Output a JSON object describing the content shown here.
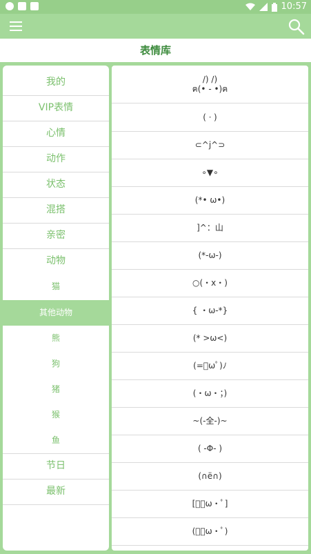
{
  "status_bar": {
    "time": "10:57",
    "icons": [
      "notification-dot-icon",
      "app-notification-icon",
      "image-notification-icon",
      "wifi-icon",
      "signal-icon",
      "battery-icon"
    ]
  },
  "toolbar": {
    "menu_icon": "hamburger-menu-icon",
    "search_icon": "search-icon",
    "accent_color": "#a5d99a"
  },
  "page_title": "表情库",
  "sidebar": {
    "categories": [
      {
        "label": "我的"
      },
      {
        "label": "VIP表情"
      },
      {
        "label": "心情"
      },
      {
        "label": "动作"
      },
      {
        "label": "状态"
      },
      {
        "label": "混搭"
      },
      {
        "label": "亲密"
      },
      {
        "label": "动物"
      }
    ],
    "subcategories": [
      {
        "label": "猫"
      },
      {
        "label": "其他动物",
        "active": true
      },
      {
        "label": "熊"
      },
      {
        "label": "狗"
      },
      {
        "label": "猪"
      },
      {
        "label": "猴"
      },
      {
        "label": "鱼"
      }
    ],
    "after": [
      {
        "label": "节日"
      },
      {
        "label": "最新"
      }
    ]
  },
  "emoticons": [
    "/) /)\nฅ(• - •)ฅ",
    "(ㆍ)",
    "⊂^j^⊃",
    "∘▼∘",
    "(*• ω•)",
    "]^：山",
    "(*-ω-)",
    "○(・x・)",
    "{ ・ω-*}",
    "(* >ω<)",
    "(=ﾟωﾟ)ﾉ",
    "(・ω・；)",
    "~(-全-)~",
    "( -Φ- )",
    "(∩ë∩)",
    "[ﾟ・ω・ﾟ]",
    "(ﾟ・ω・ﾟ)"
  ]
}
